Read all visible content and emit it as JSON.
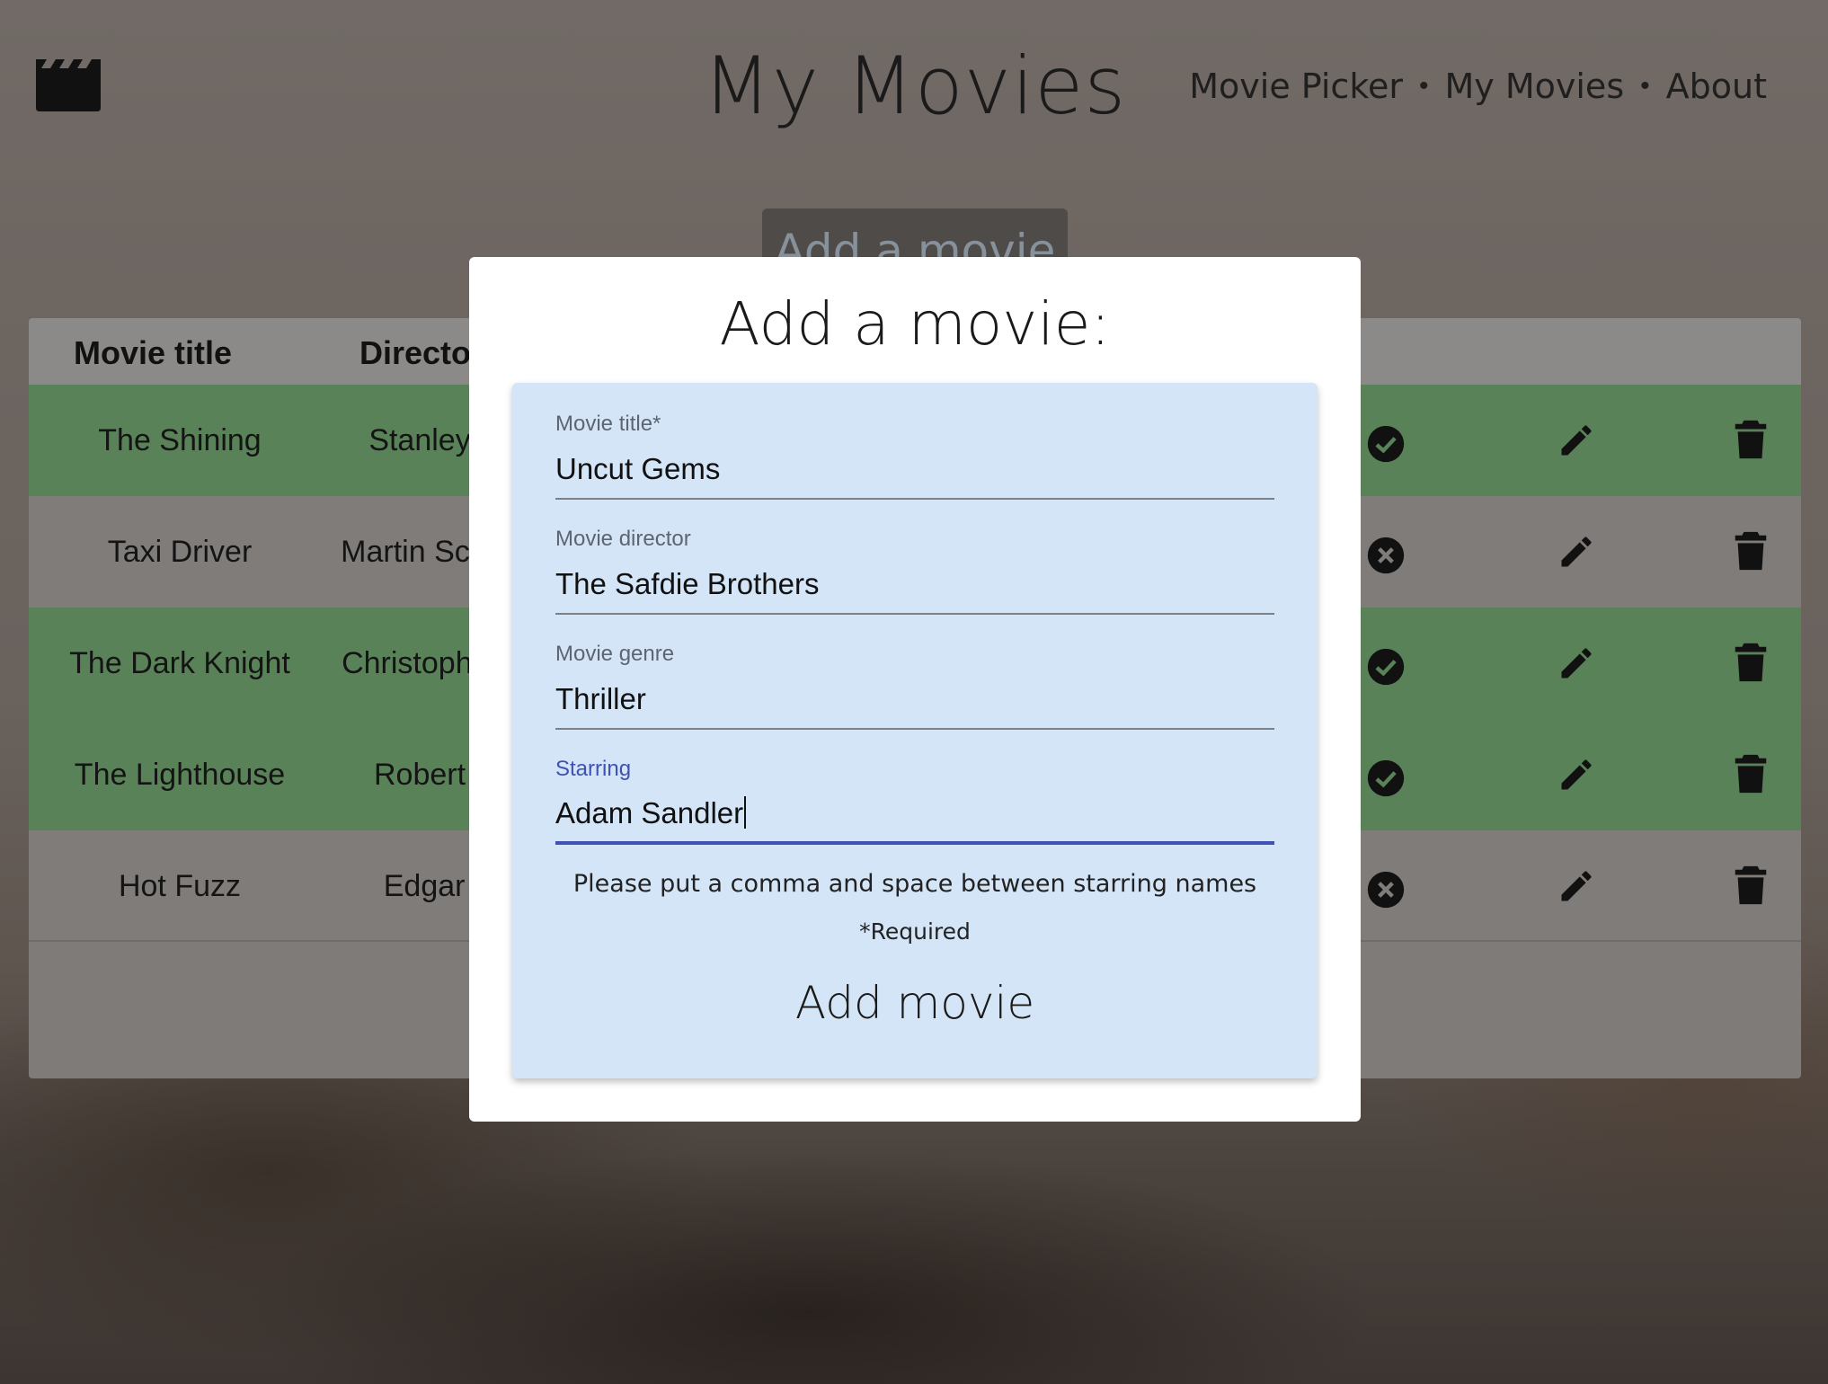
{
  "header": {
    "logo_icon": "clapperboard-icon",
    "title": "My Movies",
    "nav": [
      {
        "label": "Movie Picker"
      },
      {
        "label": "My Movies"
      },
      {
        "label": "About"
      }
    ],
    "separator": "•"
  },
  "add_button_label": "Add a movie",
  "table": {
    "headers": [
      "Movie title",
      "Directo"
    ],
    "rows": [
      {
        "title": "The Shining",
        "director": "Stanley Kub",
        "watched": true,
        "status_icon": "check-circle-icon"
      },
      {
        "title": "Taxi Driver",
        "director": "Martin Scorsese",
        "watched": false,
        "status_icon": "x-circle-icon"
      },
      {
        "title": "The Dark Knight",
        "director": "Christoph Nolan",
        "watched": true,
        "status_icon": "check-circle-icon"
      },
      {
        "title": "The Lighthouse",
        "director": "Robert Egg",
        "watched": true,
        "status_icon": "check-circle-icon"
      },
      {
        "title": "Hot Fuzz",
        "director": "Edgar Wri",
        "watched": false,
        "status_icon": "x-circle-icon"
      }
    ]
  },
  "modal": {
    "title": "Add a movie:",
    "fields": {
      "title": {
        "label": "Movie title*",
        "value": "Uncut Gems"
      },
      "director": {
        "label": "Movie director",
        "value": "The Safdie Brothers"
      },
      "genre": {
        "label": "Movie genre",
        "value": "Thriller"
      },
      "starring": {
        "label": "Starring",
        "value": "Adam Sandler"
      }
    },
    "hint": "Please put a comma and space between starring names",
    "required_note": "*Required",
    "submit_label": "Add movie"
  },
  "colors": {
    "watched_row": "#5a8258",
    "unwatched_row": "#7f7c7a",
    "form_bg": "#d4e5f7",
    "focus_accent": "#3f51b5"
  }
}
